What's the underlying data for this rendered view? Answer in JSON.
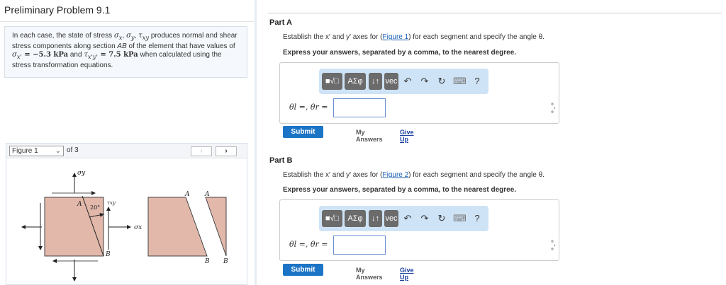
{
  "title": "Preliminary Problem 9.1",
  "intro": {
    "t1": "In each case, the state of stress ",
    "sx": "σ",
    "sx_sub": "x",
    "c1": ", ",
    "sy": "σ",
    "sy_sub": "y",
    "c2": ", ",
    "txy": "τ",
    "txy_sub": "xy",
    "t2": " produces normal and shear stress components along section ",
    "ab": "AB",
    "t3": " of the element that have values of ",
    "sxp": "σ",
    "sxp_sub": "x'",
    "eq1": " = −5.3 kPa",
    "t4": " and ",
    "txpyp": "τ",
    "txpyp_sub": "x'y'",
    "eq2": " = 7.5 kPa",
    "t5": " when calculated using the stress transformation equations."
  },
  "figure": {
    "selected": "Figure 1",
    "of": "of 3",
    "prev": "‹",
    "next": "›",
    "labels": {
      "sigma_y": "σy",
      "sigma_x": "σx",
      "tau_xy": "τxy",
      "angle": "20°",
      "A": "A",
      "B": "B"
    }
  },
  "parts": [
    {
      "label": "Part A",
      "instr_pre": "Establish the x′ and y′ axes for (",
      "link": "Figure 1",
      "instr_post": ") for each segment and specify the angle θ.",
      "express": "Express your answers, separated by a comma, to the nearest degree.",
      "answer_label": "θl =, θr =",
      "answer_value": "",
      "units": "°, °",
      "submit": "Submit",
      "my_answers": "My Answers",
      "give_up": "Give Up"
    },
    {
      "label": "Part B",
      "instr_pre": "Establish the x′ and y′ axes for (",
      "link": "Figure 2",
      "instr_post": ") for each segment and specify the angle θ.",
      "express": "Express your answers, separated by a comma, to the nearest degree.",
      "answer_label": "θl =, θr =",
      "answer_value": "",
      "units": "°, °",
      "submit": "Submit",
      "my_answers": "My Answers",
      "give_up": "Give Up"
    }
  ],
  "toolbar": {
    "templates": "■√□",
    "greek": "ΑΣφ",
    "arrows": "↓↑",
    "vec": "vec",
    "undo": "↶",
    "redo": "↷",
    "reset": "↻",
    "keyboard": "⌨",
    "help": "?"
  }
}
